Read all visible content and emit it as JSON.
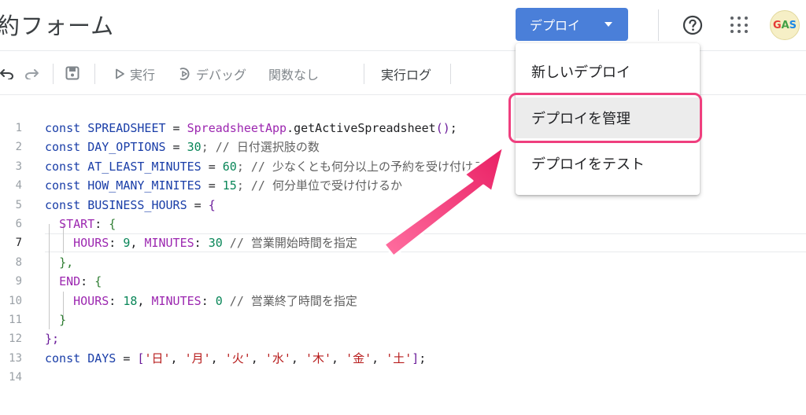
{
  "header": {
    "title": "約フォーム",
    "deploy_label": "デプロイ"
  },
  "toolbar": {
    "run_label": "実行",
    "debug_label": "デバッグ",
    "function_select": "関数なし",
    "log_label": "実行ログ"
  },
  "deploy_menu": {
    "items": [
      "新しいデプロイ",
      "デプロイを管理",
      "デプロイをテスト"
    ],
    "highlighted": "デプロイを管理"
  },
  "editor": {
    "active_line": 7,
    "line_numbers": [
      "1",
      "2",
      "3",
      "4",
      "5",
      "6",
      "7",
      "8",
      "9",
      "10",
      "11",
      "12",
      "13",
      "14"
    ],
    "lines": {
      "l1": {
        "kw": "const",
        "name": "SPREADSHEET",
        "op": " = ",
        "obj": "SpreadsheetApp",
        "call": ".getActiveSpreadsheet",
        "paren": "()",
        ";": ";"
      },
      "l2": {
        "kw": "const",
        "name": "DAY_OPTIONS",
        "op": " = ",
        "num": "30",
        "cm": "; // 日付選択肢の数"
      },
      "l3": {
        "kw": "const",
        "name": "AT_LEAST_MINUTES",
        "op": " = ",
        "num": "60",
        "cm": "; // 少なくとも何分以上の予約を受け付けるか"
      },
      "l4": {
        "kw": "const",
        "name": "HOW_MANY_MINITES",
        "op": " = ",
        "num": "15",
        "cm": "; // 何分単位で受け付けるか"
      },
      "l5": {
        "kw": "const",
        "name": "BUSINESS_HOURS",
        "op": " = ",
        "brace": "{"
      },
      "l6": {
        "key": "START",
        "sep": ": ",
        "brace": "{"
      },
      "l7": {
        "k1": "HOURS",
        "v1": "9",
        "k2": "MINUTES",
        "v2": "30",
        "cm": " // 営業開始時間を指定"
      },
      "l8": {
        "text": "},"
      },
      "l9": {
        "key": "END",
        "sep": ": ",
        "brace": "{"
      },
      "l10": {
        "k1": "HOURS",
        "v1": "18",
        "k2": "MINUTES",
        "v2": "0",
        "cm": " // 営業終了時間を指定"
      },
      "l11": {
        "text": "}"
      },
      "l12": {
        "text": "};"
      },
      "l13": {
        "kw": "const",
        "name": "DAYS",
        "op": " = ",
        "days": [
          "'日'",
          "'月'",
          "'火'",
          "'水'",
          "'木'",
          "'金'",
          "'土'"
        ]
      },
      "l14": {
        "text": ""
      }
    }
  },
  "colors": {
    "deploy_button": "#4a7fd9",
    "annotation": "#ef3f7e",
    "keyword": "#1a3ea8",
    "number": "#098658",
    "string": "#b71c1c"
  },
  "icons": [
    "undo-icon",
    "redo-icon",
    "save-icon",
    "play-icon",
    "debug-icon",
    "help-icon",
    "apps-grid-icon",
    "avatar-logo",
    "caret-down-icon"
  ],
  "avatar_text": {
    "g": "G",
    "a": "A",
    "s": "S"
  }
}
